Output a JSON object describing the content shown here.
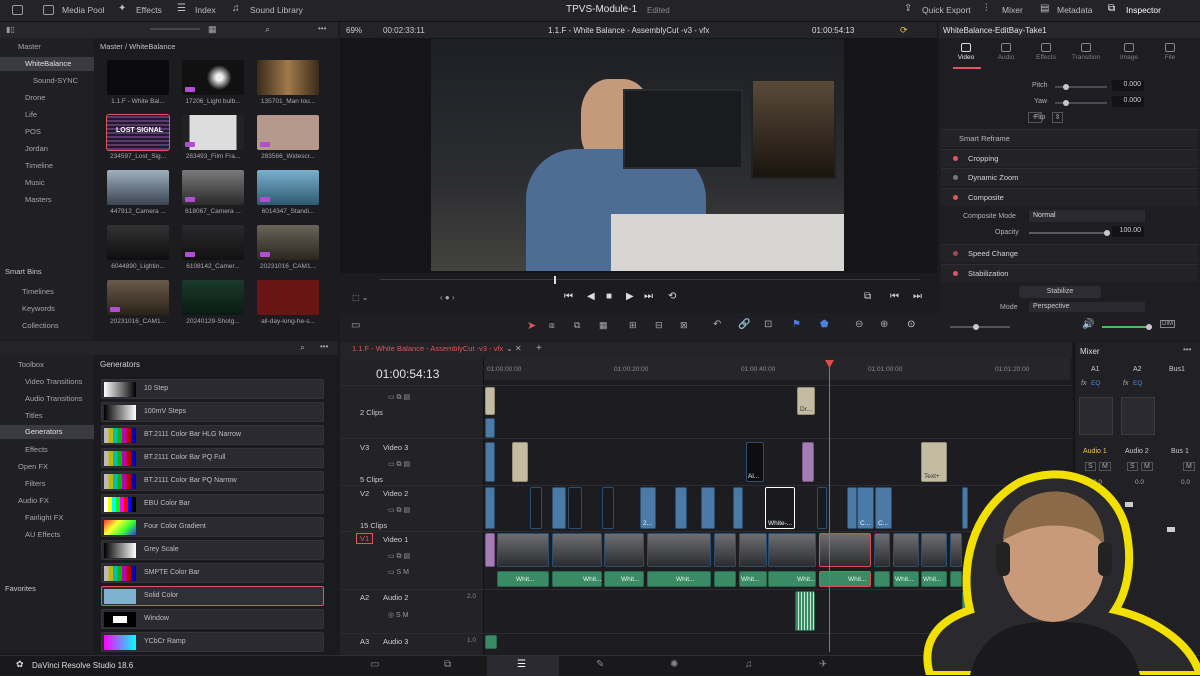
{
  "topbar": {
    "media_pool": "Media Pool",
    "effects": "Effects",
    "index": "Index",
    "sound_library": "Sound Library",
    "title": "TPVS-Module-1",
    "edited": "Edited",
    "quick_export": "Quick Export",
    "mixer": "Mixer",
    "metadata": "Metadata",
    "inspector": "Inspector"
  },
  "media_pool": {
    "bins": [
      "Master",
      "WhiteBalance",
      "Sound-SYNC",
      "Drone",
      "Life",
      "POS",
      "Jordan",
      "Timeline",
      "Music",
      "Masters"
    ],
    "smart_bins": "Smart Bins",
    "smart_items": [
      "Timelines",
      "Keywords",
      "Collections"
    ],
    "path": "Master / WhiteBalance",
    "clips": [
      "1.1.F - White Bal...",
      "17206_Light bulb...",
      "135701_Man tou...",
      "234597_Lost_Sig...",
      "283493_Film Fra...",
      "283566_Widescr...",
      "447912_Camera ...",
      "618067_Camera ...",
      "6014347_Standi...",
      "6044890_Lightin...",
      "6108142_Camer...",
      "20231016_CAM1...",
      "20231016_CAM1...",
      "20240129-Shotg...",
      "all-day-long-he-s..."
    ],
    "lost_signal": "LOST SIGNAL"
  },
  "toolbox": {
    "items": [
      "Toolbox",
      "Video Transitions",
      "Audio Transitions",
      "Titles",
      "Generators",
      "Effects",
      "Open FX",
      "Filters",
      "Audio FX",
      "Fairlight FX",
      "AU Effects"
    ],
    "favorites": "Favorites",
    "generators_heading": "Generators",
    "generators": [
      "10 Step",
      "100mV Steps",
      "BT.2111 Color Bar HLG Narrow",
      "BT.2111 Color Bar PQ Full",
      "BT.2111 Color Bar PQ Narrow",
      "EBU Color Bar",
      "Four Color Gradient",
      "Grey Scale",
      "SMPTE Color Bar",
      "Solid Color",
      "Window",
      "YCbCr Ramp"
    ]
  },
  "viewer": {
    "zoom": "69%",
    "duration": "00:02:33:11",
    "title": "1.1.F - White Balance - AssemblyCut -v3 - vfx",
    "timecode": "01:00:54:13"
  },
  "inspector": {
    "clip_name": "WhiteBalance-EditBay-Take1",
    "tabs": [
      "Video",
      "Audio",
      "Effects",
      "Transition",
      "Image",
      "File"
    ],
    "pitch_label": "Pitch",
    "pitch": "0.000",
    "yaw_label": "Yaw",
    "yaw": "0.000",
    "flip_label": "Flip",
    "smart_reframe": "Smart Reframe",
    "cropping": "Cropping",
    "dynamic_zoom": "Dynamic Zoom",
    "composite": "Composite",
    "composite_mode_label": "Composite Mode",
    "composite_mode": "Normal",
    "opacity_label": "Opacity",
    "opacity": "100.00",
    "speed_change": "Speed Change",
    "stabilization": "Stabilization",
    "stabilize": "Stabilize",
    "mode_label": "Mode",
    "mode": "Perspective"
  },
  "timeline": {
    "tab": "1.1.F - White Balance - AssemblyCut -v3 - vfx",
    "timecode": "01:00:54:13",
    "ruler": [
      "01:00:00:00",
      "01:00:20:00",
      "01:00:40:00",
      "01:01:00:00",
      "01:01:20:00"
    ],
    "clips_top": "2 Clips",
    "v3_id": "V3",
    "v3_name": "Video 3",
    "v3_clips": "5 Clips",
    "v2_id": "V2",
    "v2_name": "Video 2",
    "v2_clips": "15 Clips",
    "v1_id": "V1",
    "v1_name": "Video 1",
    "a2_id": "A2",
    "a2_name": "Audio 2",
    "a2_level": "2.0",
    "a3_id": "A3",
    "a3_name": "Audio 3",
    "a3_level": "1.0",
    "clip_labels": {
      "al": "Al...",
      "white": "White-...",
      "text": "Text+",
      "dr": "Dr...",
      "c": "C...",
      "two": "2...",
      "whit": "Whit..."
    }
  },
  "mixer": {
    "title": "Mixer",
    "channels": [
      "A1",
      "A2",
      "Bus1"
    ],
    "fx": "fx",
    "eq": "EQ",
    "names": [
      "Audio 1",
      "Audio 2",
      "Bus 1"
    ],
    "s": "S",
    "m": "M",
    "level": "0.0"
  },
  "bottom": {
    "app": "DaVinci Resolve Studio 18.6"
  }
}
